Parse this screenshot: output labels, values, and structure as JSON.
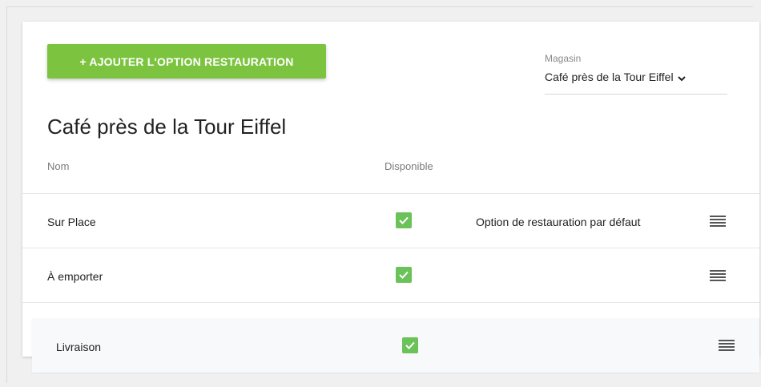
{
  "toolbar": {
    "add_label": "+ AJOUTER L'OPTION RESTAURATION"
  },
  "store": {
    "label": "Magasin",
    "value": "Café près de la Tour Eiffel"
  },
  "page": {
    "title": "Café près de la Tour Eiffel"
  },
  "columns": {
    "name": "Nom",
    "available": "Disponible"
  },
  "rows": [
    {
      "name": "Sur Place",
      "available": true,
      "default_label": "Option de restauration par défaut"
    },
    {
      "name": "À emporter",
      "available": true,
      "default_label": ""
    },
    {
      "name": "Livraison",
      "available": true,
      "default_label": ""
    }
  ],
  "colors": {
    "accent": "#7cc43f",
    "check": "#6ac259"
  },
  "icons": {
    "dropdown": "chevron-down-icon",
    "drag": "drag-handle-icon",
    "checkbox": "checkmark-icon"
  }
}
